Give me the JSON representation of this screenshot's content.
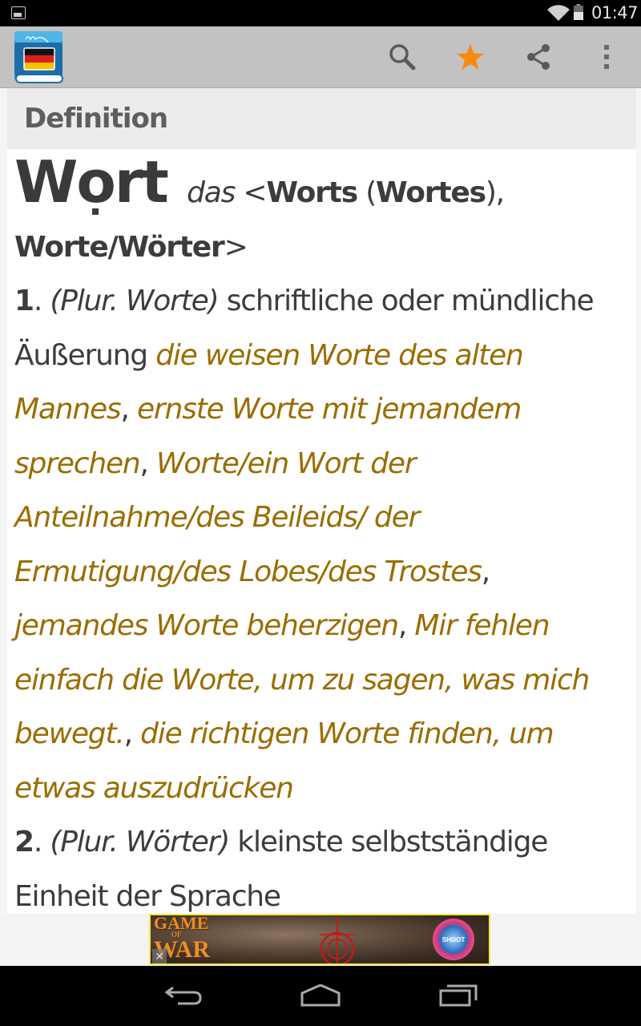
{
  "status_bar": {
    "time": "01:47",
    "icons": [
      "image-notification-icon",
      "wifi-icon",
      "battery-icon"
    ]
  },
  "action_bar": {
    "app_icon": "german-dictionary-app-icon",
    "actions": [
      {
        "name": "search",
        "icon": "search-icon"
      },
      {
        "name": "favorite",
        "icon": "star-icon",
        "active": true,
        "color": "#f98a0e"
      },
      {
        "name": "share",
        "icon": "share-icon"
      },
      {
        "name": "overflow",
        "icon": "overflow-menu-icon"
      }
    ]
  },
  "section": {
    "title": "Definition"
  },
  "entry": {
    "headword": {
      "pre": "W",
      "accented": "o",
      "post": "rt"
    },
    "gender": "das",
    "grammar": {
      "open": "<",
      "genitive": "Worts",
      "genitive_alt_open": "(",
      "genitive_alt": "Wortes",
      "genitive_alt_close": "),",
      "plural": "Worte/Wörter",
      "close": ">"
    },
    "senses": [
      {
        "number": "1",
        "label": "(Plur. Worte)",
        "definition": "schriftliche oder mündliche Äußerung",
        "examples": [
          "die weisen Worte des alten Mannes",
          "ernste Worte mit jemandem sprechen",
          "Worte/ein Wort der Anteilnahme/des Beileids/ der Ermutigung/des Lobes/des Trostes",
          "jemandes Worte beherzigen",
          "Mir fehlen einfach die Worte, um zu sagen, was mich bewegt.",
          "die richtigen Worte finden, um etwas auszudrücken"
        ]
      },
      {
        "number": "2",
        "label": "(Plur. Wörter)",
        "definition": "kleinste selbstständige Einheit der Sprache"
      }
    ],
    "colors": {
      "text": "#3c3c3c",
      "example": "#9a6d00"
    }
  },
  "ad": {
    "title_line1": "GAME",
    "title_of": "OF",
    "title_line2": "WAR",
    "button_label": "SHOOT",
    "close_label": "✕",
    "border_color": "#f5e83c"
  },
  "nav_bar": {
    "buttons": [
      "back",
      "home",
      "recent-apps"
    ]
  }
}
